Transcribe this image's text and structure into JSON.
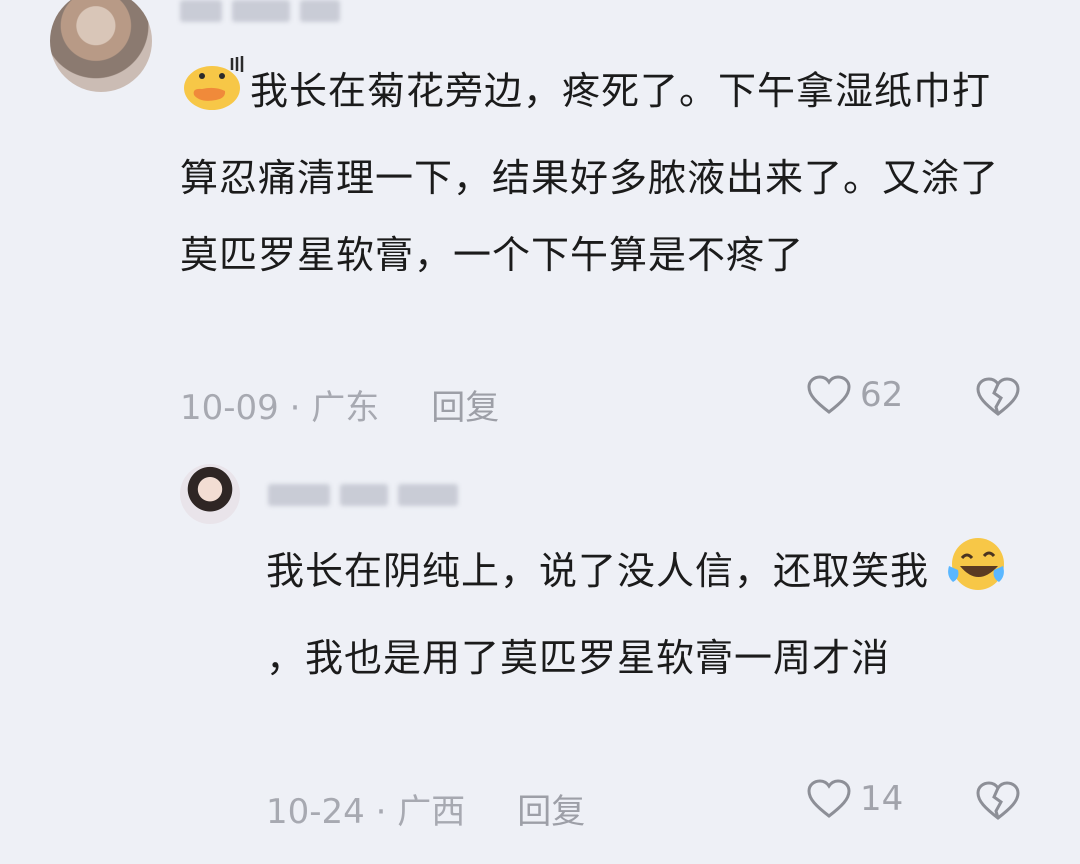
{
  "comments": [
    {
      "text": "我长在菊花旁边，疼死了。下午拿湿纸巾打算忍痛清理一下，结果好多脓液出来了。又涂了莫匹罗星软膏，一个下午算是不疼了",
      "date_location": "10-09 · 广东",
      "reply_label": "回复",
      "likes": "62",
      "emoji": "duck-sweat-emoji"
    },
    {
      "text": "我长在阴纯上，说了没人信，还取笑我",
      "text_after_emoji": "，我也是用了莫匹罗星软膏一周才消",
      "date_location": "10-24 · 广西",
      "reply_label": "回复",
      "likes": "14",
      "emoji": "laugh-cry-emoji"
    }
  ],
  "icons": {
    "like": "heart-outline-icon",
    "dislike": "broken-heart-outline-icon"
  },
  "colors": {
    "background": "#eef0f6",
    "text": "#1b1b1b",
    "meta": "#a7a9b1",
    "icon": "#8d8f97"
  }
}
